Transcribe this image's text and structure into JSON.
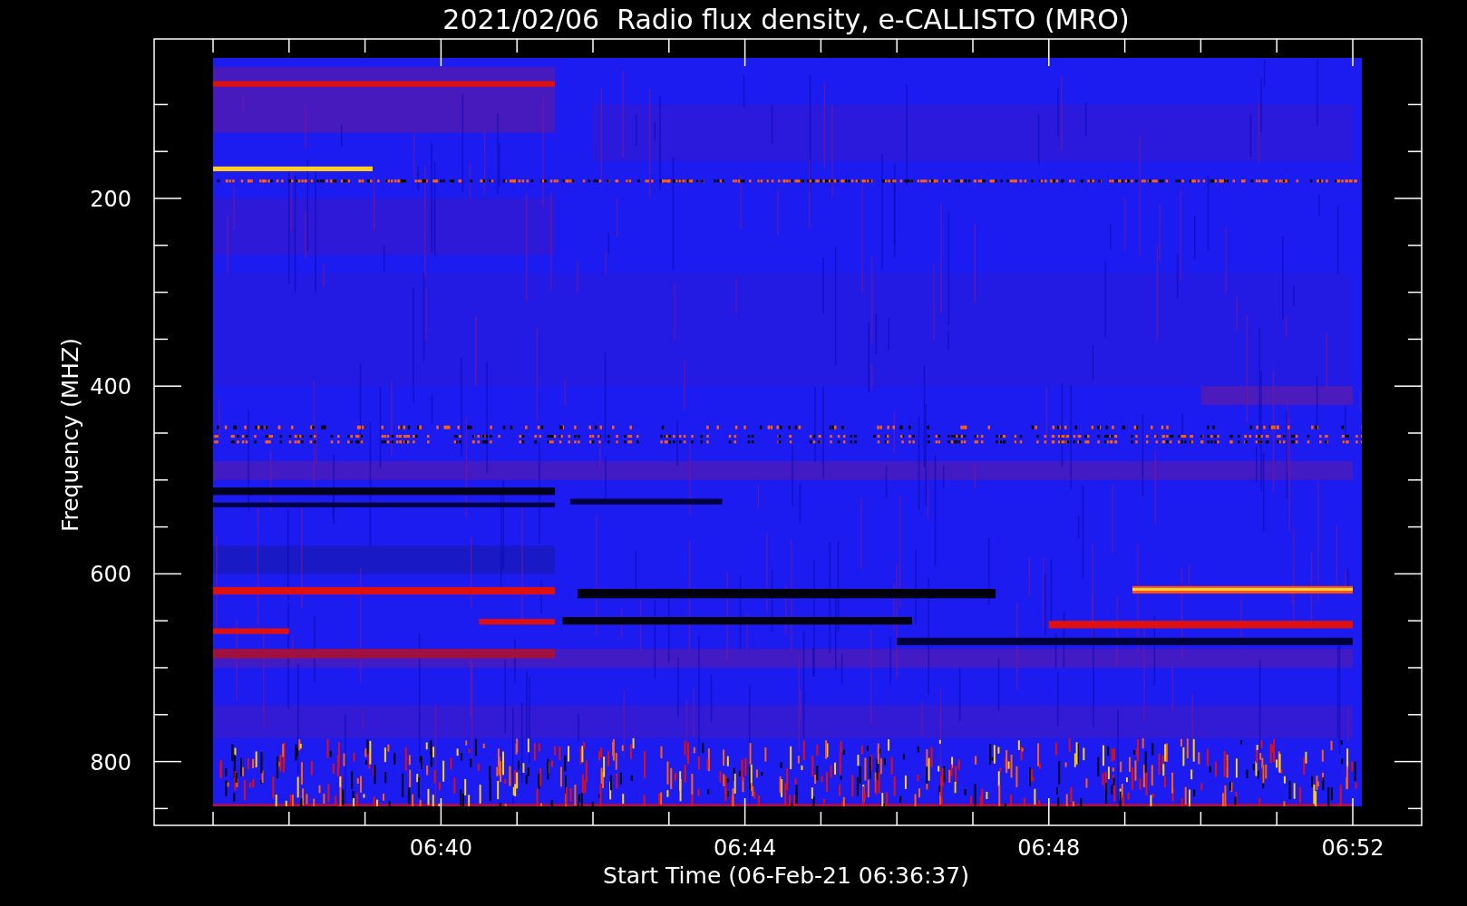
{
  "title": "2021/02/06  Radio flux density, e-CALLISTO (MRO)",
  "ylabel": "Frequency (MHZ)",
  "xlabel": "Start Time (06-Feb-21 06:36:37)",
  "yticks": [
    "200",
    "400",
    "600",
    "800"
  ],
  "xticks": [
    "06:40",
    "06:44",
    "06:48",
    "06:52"
  ]
}
